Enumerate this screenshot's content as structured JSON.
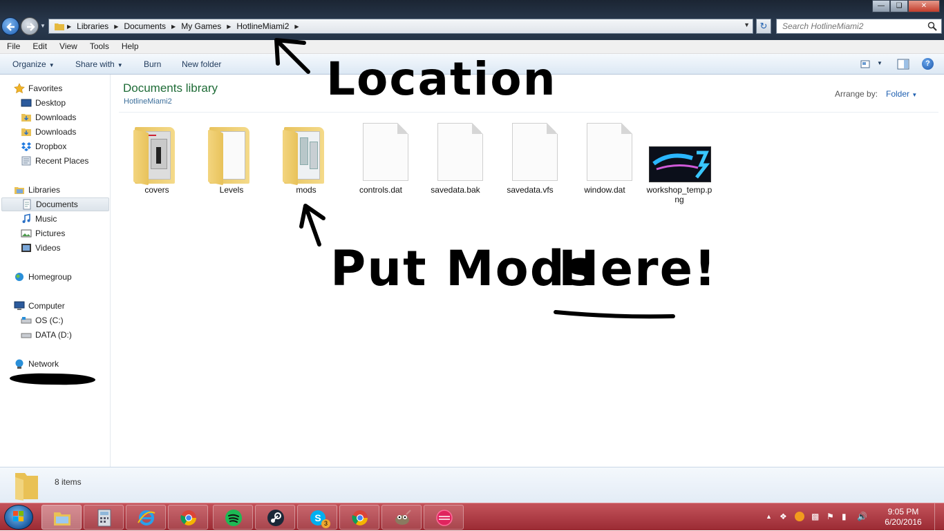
{
  "address": {
    "crumbs": [
      "Libraries",
      "Documents",
      "My Games",
      "HotlineMiami2"
    ]
  },
  "search": {
    "placeholder": "Search HotlineMiami2"
  },
  "menu": {
    "items": [
      "File",
      "Edit",
      "View",
      "Tools",
      "Help"
    ]
  },
  "commandbar": {
    "organize": "Organize",
    "share_with": "Share with",
    "burn": "Burn",
    "new_folder": "New folder"
  },
  "nav": {
    "favorites": "Favorites",
    "desktop": "Desktop",
    "downloads1": "Downloads",
    "downloads2": "Downloads",
    "dropbox": "Dropbox",
    "recent_places": "Recent Places",
    "libraries": "Libraries",
    "documents": "Documents",
    "music": "Music",
    "pictures": "Pictures",
    "videos": "Videos",
    "homegroup": "Homegroup",
    "computer": "Computer",
    "os_c": "OS (C:)",
    "data_d": "DATA (D:)",
    "network": "Network"
  },
  "content": {
    "library_title": "Documents library",
    "library_subtitle": "HotlineMiami2",
    "arrange_label": "Arrange by:",
    "arrange_value": "Folder",
    "items": [
      {
        "name": "covers",
        "kind": "folder"
      },
      {
        "name": "Levels",
        "kind": "folder"
      },
      {
        "name": "mods",
        "kind": "folder"
      },
      {
        "name": "controls.dat",
        "kind": "file"
      },
      {
        "name": "savedata.bak",
        "kind": "file"
      },
      {
        "name": "savedata.vfs",
        "kind": "file"
      },
      {
        "name": "window.dat",
        "kind": "file"
      },
      {
        "name": "workshop_temp.png",
        "kind": "image"
      }
    ]
  },
  "annotations": {
    "location": "Location",
    "put_mods": "Put Mods",
    "here": "Here!"
  },
  "status": {
    "item_count": "8 items"
  },
  "taskbar": {
    "time": "9:05 PM",
    "date": "6/20/2016",
    "skype_badge": "3"
  },
  "colors": {
    "library_title": "#1e6b36",
    "link_blue": "#1e5fb0",
    "taskbar": "#b03a44"
  }
}
